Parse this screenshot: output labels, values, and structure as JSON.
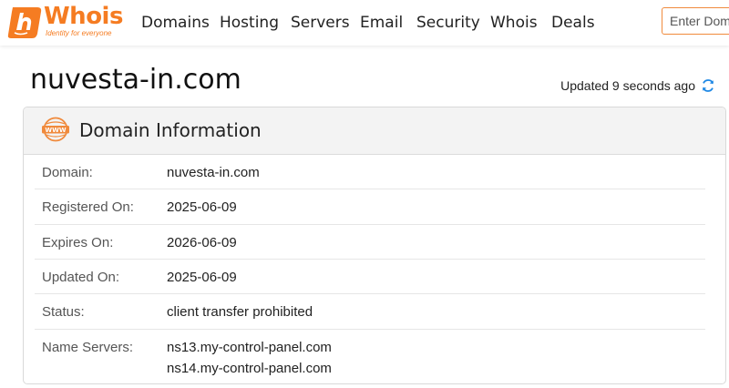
{
  "brand": {
    "name": "Whois",
    "tagline": "Identity for everyone",
    "color": "#f57c22"
  },
  "nav": {
    "items": [
      "Domains",
      "Hosting",
      "Servers",
      "Email",
      "Security",
      "Whois",
      "Deals"
    ]
  },
  "search": {
    "placeholder": "Enter Domain"
  },
  "page": {
    "domain": "nuvesta-in.com",
    "updated": "Updated 9 seconds ago",
    "refresh_icon": "refresh-icon"
  },
  "card": {
    "icon": "www-icon",
    "title": "Domain Information",
    "rows": [
      {
        "label": "Domain:",
        "values": [
          "nuvesta-in.com"
        ]
      },
      {
        "label": "Registered On:",
        "values": [
          "2025-06-09"
        ]
      },
      {
        "label": "Expires On:",
        "values": [
          "2026-06-09"
        ]
      },
      {
        "label": "Updated On:",
        "values": [
          "2025-06-09"
        ]
      },
      {
        "label": "Status:",
        "values": [
          "client transfer prohibited"
        ]
      },
      {
        "label": "Name Servers:",
        "values": [
          "ns13.my-control-panel.com",
          "ns14.my-control-panel.com"
        ]
      }
    ]
  },
  "colors": {
    "accent": "#f57c22",
    "refresh": "#1e88e5"
  }
}
